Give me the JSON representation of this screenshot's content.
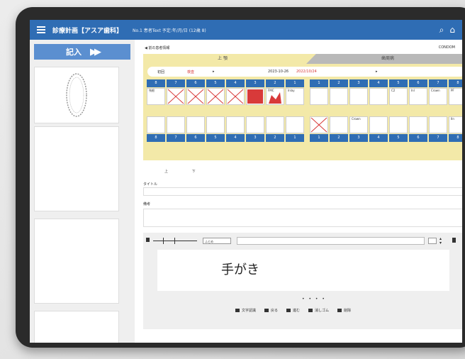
{
  "header": {
    "app_title": "診療計画【アスア歯科】",
    "patient_info": "No.1 患者Text 予定:年/月/日 (12歳 8)",
    "search_icon": "search-icon",
    "home_icon": "home-icon"
  },
  "sidebar": {
    "fill_button_label": "記入",
    "fill_button_icon": "double-arrow-right-icon"
  },
  "main": {
    "back_link": "◀ 前の患者情報",
    "right_link": "CONDOM",
    "tabs": {
      "upper": "上 顎",
      "lower": "歯周病"
    },
    "info_row": {
      "label1": "初回",
      "label2": "検査",
      "mark": "▸",
      "date": "2023-10-26",
      "date_red": "2022/10/24",
      "mark2": "▸"
    },
    "upper_numbers": [
      "8",
      "7",
      "6",
      "5",
      "4",
      "3",
      "2",
      "1",
      "1",
      "2",
      "3",
      "4",
      "5",
      "6",
      "7",
      "8"
    ],
    "lower_numbers": [
      "8",
      "7",
      "6",
      "5",
      "4",
      "3",
      "2",
      "1",
      "1",
      "2",
      "3",
      "4",
      "5",
      "6",
      "7",
      "8"
    ],
    "upper_cell_text": [
      "残根",
      "",
      "",
      "",
      "",
      "",
      "FMC",
      "Inlay",
      "",
      "",
      "",
      "",
      "C2",
      "Inl",
      "Crown",
      "PF"
    ],
    "lower_cell_text": [
      "",
      "",
      "",
      "",
      "",
      "",
      "",
      "",
      "",
      "",
      "Crown",
      "",
      "",
      "",
      "",
      "IIn"
    ],
    "radio_options": [
      "上",
      "下"
    ],
    "field_title_label": "タイトル",
    "field_memo_label": "備考",
    "hw": {
      "pen_select": "ふとめ",
      "pen_select2": "",
      "handwriting_text": "手がき",
      "tools": [
        "文字認識",
        "戻る",
        "進む",
        "消しゴム",
        "削除"
      ],
      "pagination": "• • • •"
    }
  },
  "colors": {
    "header_blue": "#2f6db4",
    "tab_yellow": "#f3e9a8",
    "tooth_red": "#d83a3a",
    "fill_button_blue": "#5b8fd0"
  }
}
